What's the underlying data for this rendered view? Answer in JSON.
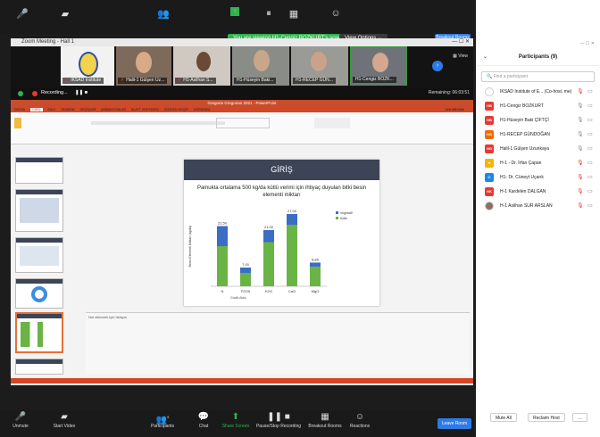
{
  "topbar": {
    "unmute": "Unmute",
    "start_video": "Start Video"
  },
  "share_banner": "You are viewing H1-Cengiz BOZKURT's screen",
  "view_options": "View Options",
  "rooms_label": "Breakout Rooms",
  "window": {
    "title": "Zoom Meeting - Hall 1"
  },
  "tiles": [
    {
      "name": "IKSAD Institute"
    },
    {
      "name": "Halil-1 Gülşen Uz..."
    },
    {
      "name": "H1-Asilhan S..."
    },
    {
      "name": "H1-Hüseyin Baki..."
    },
    {
      "name": "H1-RECEP GÜN..."
    },
    {
      "name": "H1-Cengiz BOZK..."
    }
  ],
  "view_label": "View",
  "recording": {
    "label": "Recording...",
    "remaining": "Remaining: 06:03:51"
  },
  "ppt": {
    "title": "Gregoria Gregorian 2021 - PowerPoint",
    "tabs": [
      "DOSYA",
      "GİRİŞ",
      "EKLE",
      "TASARIM",
      "GEÇİŞLER",
      "ANİMASYONLAR",
      "SLAYT GÖSTERİSİ",
      "GÖZDEN GEÇİR",
      "GÖRÜNÜM"
    ],
    "user": "Zeki Mili Birlik"
  },
  "slide": {
    "header": "GİRİŞ",
    "subtitle": "Pamukta ortalama 500 kg/da kütlü verimi için ihtiyaç duyulan bitki besin elementi miktarı"
  },
  "chart_data": {
    "type": "bar",
    "categories": [
      "N",
      "P2O5",
      "K2O",
      "CaO",
      "MgO"
    ],
    "series": [
      {
        "name": "Vegetatif",
        "color": "#3b6cc6",
        "values": [
          7.5,
          2.0,
          4.5,
          4.0,
          1.5
        ]
      },
      {
        "name": "Kütle",
        "color": "#6ab445",
        "values": [
          15.0,
          5.0,
          16.5,
          23.0,
          7.35
        ]
      }
    ],
    "totals": [
      "22,50",
      "7,00",
      "21,00",
      "27,00",
      "8,85"
    ],
    "ylabel": "Besin Elementi Miktarı (kg/da)",
    "ylim": [
      0,
      30
    ]
  },
  "tooltip": "Grafik Alanı",
  "notes": "Not eklemek için tıklayın",
  "bottombar": {
    "unmute": "Unmute",
    "start_video": "Start Video",
    "participants": "Participants",
    "participants_count": "9",
    "chat": "Chat",
    "share_screen": "Share Screen",
    "pause_recording": "Pause/Stop Recording",
    "breakout_rooms": "Breakout Rooms",
    "reactions": "Reactions",
    "leave": "Leave Room"
  },
  "panel": {
    "title": "Participants (9)",
    "search_placeholder": "Find a participant",
    "participants": [
      {
        "name": "IKSAD Institute of E... (Co-host, me)",
        "initials": "",
        "color": "#ffffff",
        "mic_muted": true
      },
      {
        "name": "H1-Cengiz BOZKURT",
        "initials": "HB",
        "color": "#e53935",
        "mic_muted": false
      },
      {
        "name": "H1-Hüseyin Baki ÇİFTÇİ",
        "initials": "HB",
        "color": "#e53935",
        "mic_muted": false
      },
      {
        "name": "H1-RECEP GÜNDOĞAN",
        "initials": "HG",
        "color": "#ef6c00",
        "mic_muted": false
      },
      {
        "name": "Halil-1 Gülşen Uzunkaya",
        "initials": "HG",
        "color": "#e53935",
        "mic_muted": false
      },
      {
        "name": "H-1 - Dr. İrfan Çapan",
        "initials": "H",
        "color": "#f5b400",
        "mic_muted": true
      },
      {
        "name": "H1- Dr. Cüneyt Uçarık",
        "initials": "C",
        "color": "#1e88e5",
        "mic_muted": true
      },
      {
        "name": "H-1 Kardelen DALGAN",
        "initials": "HK",
        "color": "#e53935",
        "mic_muted": true
      },
      {
        "name": "H-1 Asilhan SUR ARSLAN",
        "initials": "",
        "color": "#8d6e63",
        "mic_muted": true
      }
    ],
    "mute_all": "Mute All",
    "reclaim_host": "Reclaim Host"
  }
}
